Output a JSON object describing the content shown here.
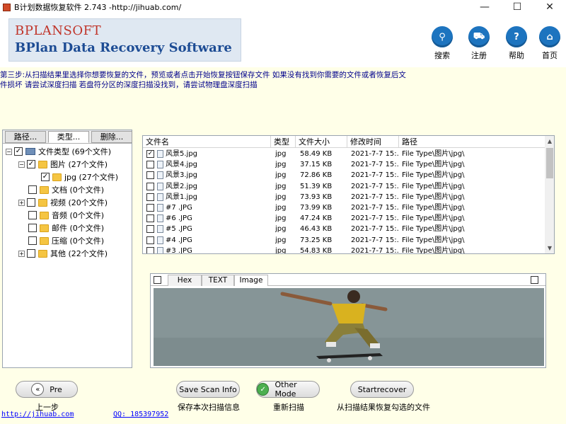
{
  "window": {
    "title": "B计划数据恢复软件 2.743 -http://jihuab.com/",
    "minimize": "—",
    "maximize": "☐",
    "close": "✕"
  },
  "brand": {
    "logo_name": "BPLANSOFT",
    "product": "BPlan Data Recovery Software"
  },
  "nav": [
    {
      "label": "搜索",
      "icon": "search-icon",
      "glyph": "⚲"
    },
    {
      "label": "注册",
      "icon": "cart-icon",
      "glyph": "⛟"
    },
    {
      "label": "帮助",
      "icon": "help-icon",
      "glyph": "?"
    },
    {
      "label": "首页",
      "icon": "home-icon",
      "glyph": "⌂"
    }
  ],
  "instructions": {
    "line1": "第三步:从扫描结果里选择你想要恢复的文件，预览或者点击开始恢复按钮保存文件 如果没有找到你需要的文件或者恢复后文",
    "line2": "件损坏 请尝试深度扫描 若盘符分区的深度扫描没找到，请尝试物理盘深度扫描"
  },
  "left_tabs": [
    {
      "label": "路径..."
    },
    {
      "label": "类型..."
    },
    {
      "label": "删除..."
    }
  ],
  "tree": [
    {
      "label": "文件类型 (69个文件)",
      "checked": true,
      "expander": "−",
      "icon": "drive"
    },
    {
      "label": "图片 (27个文件)",
      "checked": true,
      "expander": "−",
      "icon": "folder"
    },
    {
      "label": "jpg (27个文件)",
      "checked": true,
      "expander": "",
      "icon": "folder"
    },
    {
      "label": "文档 (0个文件)",
      "checked": false,
      "expander": "",
      "icon": "folder"
    },
    {
      "label": "视频 (20个文件)",
      "checked": false,
      "expander": "+",
      "icon": "folder"
    },
    {
      "label": "音频 (0个文件)",
      "checked": false,
      "expander": "",
      "icon": "folder"
    },
    {
      "label": "邮件 (0个文件)",
      "checked": false,
      "expander": "",
      "icon": "folder"
    },
    {
      "label": "压缩 (0个文件)",
      "checked": false,
      "expander": "",
      "icon": "folder"
    },
    {
      "label": "其他 (22个文件)",
      "checked": false,
      "expander": "+",
      "icon": "folder"
    }
  ],
  "file_list": {
    "columns": [
      "文件名",
      "类型",
      "文件大小",
      "修改时间",
      "路径"
    ],
    "rows": [
      {
        "checked": true,
        "name": "风景5.jpg",
        "type": "jpg",
        "size": "58.49 KB",
        "time": "2021-7-7 15:...",
        "path": "File Type\\图片\\jpg\\"
      },
      {
        "checked": false,
        "name": "风景4.jpg",
        "type": "jpg",
        "size": "37.15 KB",
        "time": "2021-7-7 15:...",
        "path": "File Type\\图片\\jpg\\"
      },
      {
        "checked": false,
        "name": "风景3.jpg",
        "type": "jpg",
        "size": "72.86 KB",
        "time": "2021-7-7 15:...",
        "path": "File Type\\图片\\jpg\\"
      },
      {
        "checked": false,
        "name": "风景2.jpg",
        "type": "jpg",
        "size": "51.39 KB",
        "time": "2021-7-7 15:...",
        "path": "File Type\\图片\\jpg\\"
      },
      {
        "checked": false,
        "name": "风景1.jpg",
        "type": "jpg",
        "size": "73.93 KB",
        "time": "2021-7-7 15:...",
        "path": "File Type\\图片\\jpg\\"
      },
      {
        "checked": false,
        "name": "#7      .JPG",
        "type": "jpg",
        "size": "73.99 KB",
        "time": "2021-7-7 15:...",
        "path": "File Type\\图片\\jpg\\"
      },
      {
        "checked": false,
        "name": "#6      .JPG",
        "type": "jpg",
        "size": "47.24 KB",
        "time": "2021-7-7 15:...",
        "path": "File Type\\图片\\jpg\\"
      },
      {
        "checked": false,
        "name": "#5      .JPG",
        "type": "jpg",
        "size": "46.43 KB",
        "time": "2021-7-7 15:...",
        "path": "File Type\\图片\\jpg\\"
      },
      {
        "checked": false,
        "name": "#4      .JPG",
        "type": "jpg",
        "size": "73.25 KB",
        "time": "2021-7-7 15:...",
        "path": "File Type\\图片\\jpg\\"
      },
      {
        "checked": false,
        "name": "#3      .JPG",
        "type": "jpg",
        "size": "54.83 KB",
        "time": "2021-7-7 15:...",
        "path": "File Type\\图片\\jpg\\"
      }
    ]
  },
  "preview_tabs": [
    {
      "label": "Hex"
    },
    {
      "label": "TEXT"
    },
    {
      "label": "Image"
    }
  ],
  "buttons": [
    {
      "label": "Pre",
      "glyph": "«",
      "caption": "上一步"
    },
    {
      "label": "Save Scan Info",
      "glyph": "",
      "caption": "保存本次扫描信息"
    },
    {
      "label": "Other Mode",
      "glyph": "✓",
      "caption": "重新扫描"
    },
    {
      "label": "Startrecover",
      "glyph": "",
      "caption": "从扫描结果恢复勾选的文件"
    }
  ],
  "footer": {
    "website": "http://jihuab.com",
    "qq": "QQ: 185397952"
  },
  "colors": {
    "accent": "#1d74bf",
    "brand_red": "#c0352a",
    "brand_blue": "#1d4c94",
    "background": "#ffffe8"
  }
}
